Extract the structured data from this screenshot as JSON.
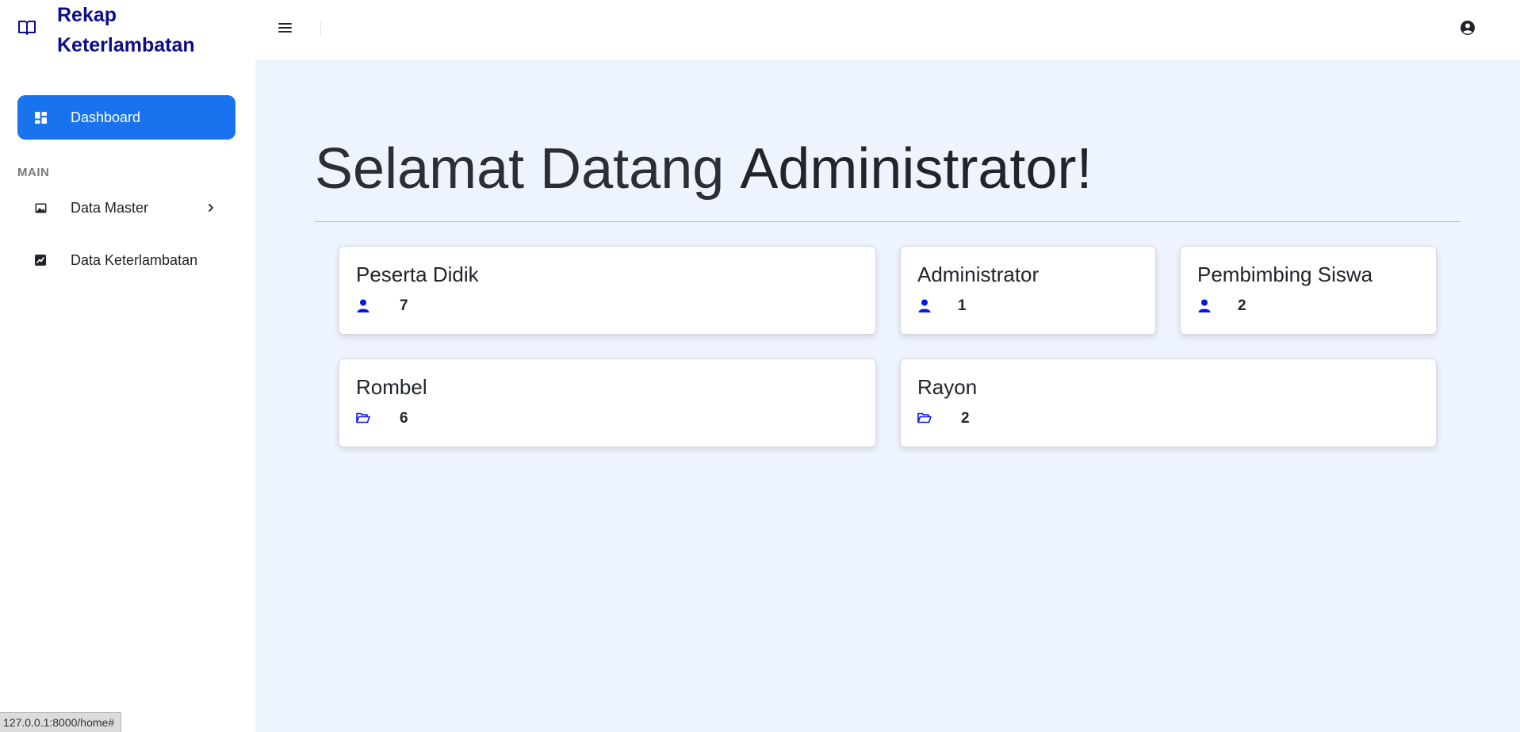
{
  "app": {
    "title": "Rekap Keterlambatan",
    "brand_color": "#0d0d8a",
    "accent": "#1a73ee"
  },
  "sidebar": {
    "active_item": {
      "label": "Dashboard",
      "icon": "dashboard-icon"
    },
    "section_label": "MAIN",
    "items": [
      {
        "label": "Data Master",
        "icon": "image-icon",
        "has_submenu": true
      },
      {
        "label": "Data Keterlambatan",
        "icon": "chart-line-icon",
        "has_submenu": false
      }
    ]
  },
  "topbar": {
    "menu_icon": "hamburger-icon",
    "user_icon": "user-circle-icon"
  },
  "main": {
    "welcome_light": "Selamat Datang",
    "welcome_strong": "Administrator!",
    "cards": [
      {
        "title": "Peserta Didik",
        "icon": "user-icon",
        "count": "7"
      },
      {
        "title": "Administrator",
        "icon": "user-icon",
        "count": "1"
      },
      {
        "title": "Pembimbing Siswa",
        "icon": "user-icon",
        "count": "2"
      },
      {
        "title": "Rombel",
        "icon": "folder-open-icon",
        "count": "6"
      },
      {
        "title": "Rayon",
        "icon": "folder-open-icon",
        "count": "2"
      }
    ],
    "icon_color": "#0a16e6"
  },
  "status_bar": {
    "url": "127.0.0.1:8000/home#"
  }
}
